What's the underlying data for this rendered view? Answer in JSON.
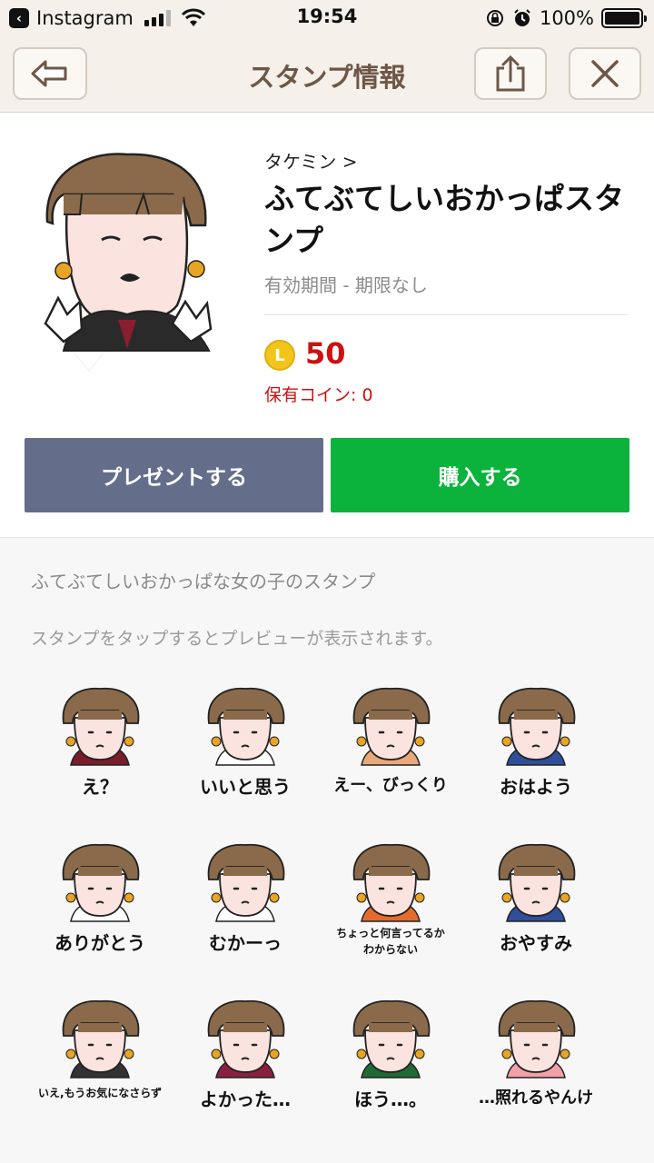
{
  "status_bar": {
    "back_app": "Instagram",
    "time": "19:54",
    "battery": "100%"
  },
  "header": {
    "title": "スタンプ情報"
  },
  "product": {
    "creator": "タケミン >",
    "title": "ふてぶてしいおかっぱスタンプ",
    "validity": "有効期間 - 期限なし",
    "coin_symbol": "L",
    "price": "50",
    "owned_coins": "保有コイン: 0"
  },
  "actions": {
    "present_label": "プレゼントする",
    "buy_label": "購入する"
  },
  "description": {
    "text": "ふてぶてしいおかっぱな女の子のスタンプ",
    "hint": "スタンプをタップするとプレビューが表示されます。"
  },
  "stickers": [
    {
      "caption": "え？",
      "shirt": "#7a1d2b"
    },
    {
      "caption": "いいと思う",
      "shirt": "#ffffff"
    },
    {
      "caption": "えー、びっくり",
      "shirt": "#e8a87a"
    },
    {
      "caption": "おはよう",
      "shirt": "#2f4f9a"
    },
    {
      "caption": "ありがとう",
      "shirt": "#ffffff"
    },
    {
      "caption": "むかーっ",
      "shirt": "#ffffff"
    },
    {
      "caption": "ちょっと何言ってるか\nわからない",
      "shirt": "#e66a2c"
    },
    {
      "caption": "おやすみ",
      "shirt": "#2f4f9a"
    },
    {
      "caption": "いえ,もうお気になさらず",
      "shirt": "#333333"
    },
    {
      "caption": "よかった…",
      "shirt": "#8a2040"
    },
    {
      "caption": "ほう…。",
      "shirt": "#1f6a35"
    },
    {
      "caption": "…照れるやんけ",
      "shirt": "#f2a0a8"
    }
  ],
  "colors": {
    "header_bg": "#f5f0ea",
    "title_brown": "#6e5747",
    "present_btn": "#646d8a",
    "buy_btn": "#0bb33d",
    "price_red": "#cc1111"
  }
}
